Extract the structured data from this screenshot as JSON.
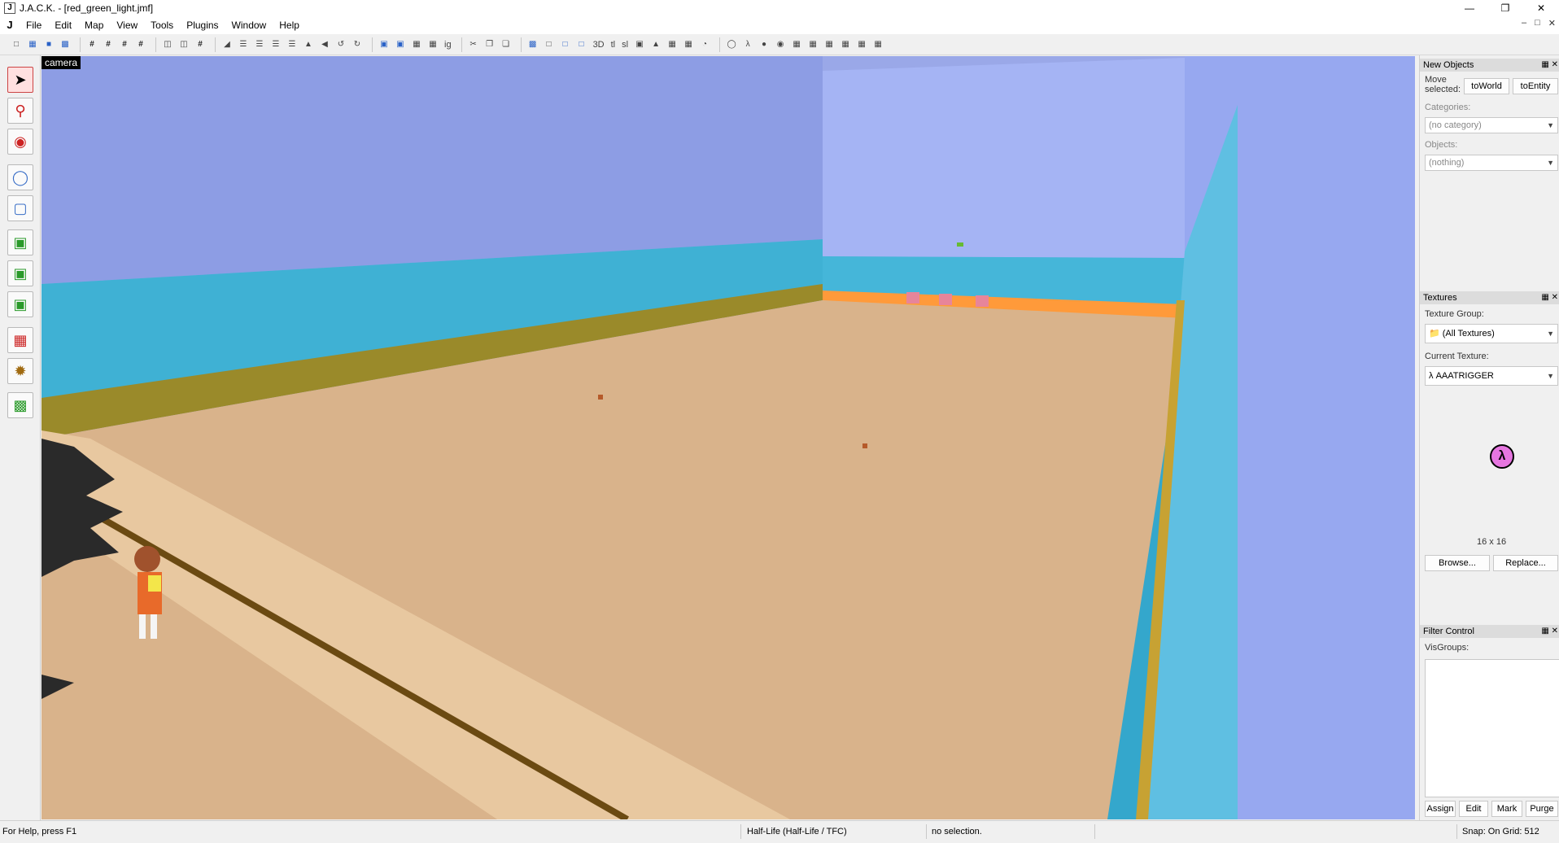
{
  "window": {
    "title": "J.A.C.K. - [red_green_light.jmf]",
    "minimize": "—",
    "maximize": "❐",
    "close": "✕"
  },
  "menu": {
    "items": [
      "File",
      "Edit",
      "Map",
      "View",
      "Tools",
      "Plugins",
      "Window",
      "Help"
    ],
    "mdi_min": "–",
    "mdi_restore": "□",
    "mdi_close": "✕"
  },
  "toolbar": {
    "text_buttons": {
      "tl": "tl",
      "sl": "sl",
      "ig": "ig",
      "threed": "3D"
    }
  },
  "viewport": {
    "label": "camera",
    "colors": {
      "sky_wall": "#8f9fe6",
      "sky_wall_light": "#a9b7f5",
      "sea": "#3fb3d6",
      "sand": "#dbb58e",
      "path": "#e9c9a3",
      "track": "#6b4a12"
    }
  },
  "panels": {
    "new_objects": {
      "title": "New Objects",
      "move_selected_label": "Move selected:",
      "to_world": "toWorld",
      "to_entity": "toEntity",
      "categories_label": "Categories:",
      "categories_value": "(no category)",
      "objects_label": "Objects:",
      "objects_value": "(nothing)"
    },
    "textures": {
      "title": "Textures",
      "group_label": "Texture Group:",
      "group_value": "(All Textures)",
      "current_label": "Current Texture:",
      "current_value": "AAATRIGGER",
      "size": "16 x 16",
      "browse": "Browse...",
      "replace": "Replace..."
    },
    "filter": {
      "title": "Filter Control",
      "visgroups_label": "VisGroups:",
      "assign": "Assign",
      "edit": "Edit",
      "mark": "Mark",
      "purge": "Purge"
    }
  },
  "status": {
    "help": "For Help, press F1",
    "game": "Half-Life (Half-Life / TFC)",
    "selection": "no selection.",
    "snap": "Snap: On Grid: 512"
  }
}
